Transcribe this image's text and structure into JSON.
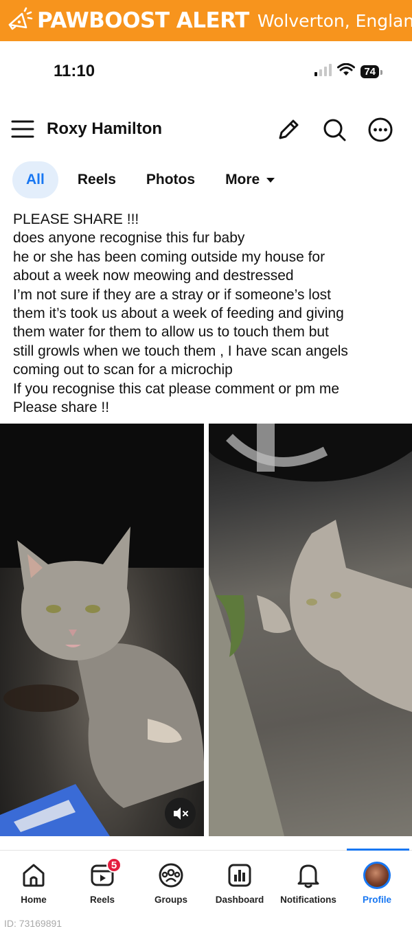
{
  "banner": {
    "brand": "PAWBOOST ALERT",
    "location": "Wolverton, England",
    "color": "#f7941d"
  },
  "status_bar": {
    "time": "11:10",
    "battery": "74"
  },
  "header": {
    "profile_name": "Roxy Hamilton",
    "icons": [
      "menu-icon",
      "edit-icon",
      "search-icon",
      "more-icon"
    ]
  },
  "tabs": [
    {
      "label": "All",
      "active": true
    },
    {
      "label": "Reels",
      "active": false
    },
    {
      "label": "Photos",
      "active": false
    },
    {
      "label": "More",
      "active": false
    }
  ],
  "post": {
    "lines": [
      "PLEASE SHARE !!!",
      "does anyone recognise this fur baby",
      "he or she has been coming outside my house for",
      "about a week now meowing and destressed",
      "I’m not sure if they are a stray or if someone’s lost",
      "them it’s took us about a week of feeding and giving",
      "them water for them to allow us to touch them but",
      "still growls when we touch them , I have scan angels",
      "coming out to scan for a microchip",
      "If you recognise this cat please comment or pm me",
      "Please share !!"
    ]
  },
  "media": {
    "photos": [
      "cat-photo-left",
      "cat-photo-right"
    ],
    "mute_icon": "mute-icon"
  },
  "bottom_nav": [
    {
      "label": "Home",
      "icon": "home-icon",
      "active": false
    },
    {
      "label": "Reels",
      "icon": "reels-icon",
      "active": false,
      "badge": "5"
    },
    {
      "label": "Groups",
      "icon": "groups-icon",
      "active": false
    },
    {
      "label": "Dashboard",
      "icon": "dashboard-icon",
      "active": false
    },
    {
      "label": "Notifications",
      "icon": "bell-icon",
      "active": false
    },
    {
      "label": "Profile",
      "icon": "avatar",
      "active": true
    }
  ],
  "colors": {
    "accent": "#1877f2",
    "badge": "#e41e3f",
    "tab_active_bg": "#e3eefb"
  },
  "footer": {
    "id_text": "ID: 73169891"
  }
}
